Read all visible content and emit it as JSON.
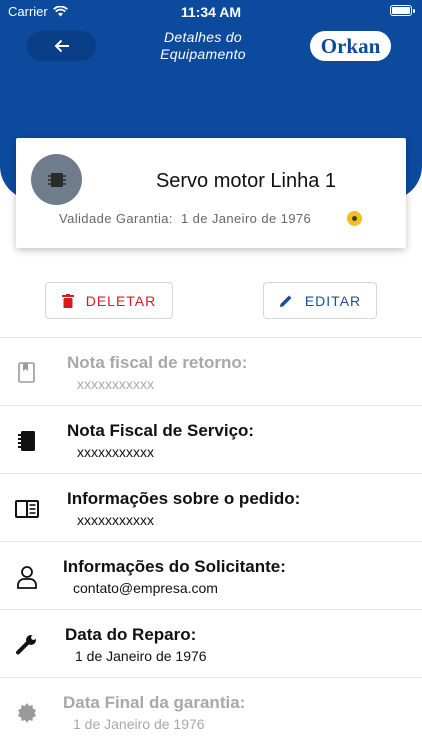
{
  "status_bar": {
    "carrier": "Carrier",
    "time": "11:34 AM"
  },
  "header": {
    "title": "Detalhes do Equipamento",
    "logo_text": "Orkan"
  },
  "device": {
    "name": "Servo motor Linha 1",
    "warranty_label": "Validade Garantia:",
    "warranty_date": "1 de Janeiro de 1976"
  },
  "actions": {
    "delete_label": "DELETAR",
    "edit_label": "EDITAR"
  },
  "details": [
    {
      "label": "Nota fiscal de retorno:",
      "value": "xxxxxxxxxxx",
      "icon": "bookmark-book-icon",
      "disabled": true
    },
    {
      "label": "Nota Fiscal de Serviço:",
      "value": "xxxxxxxxxxx",
      "icon": "notebook-icon",
      "disabled": false
    },
    {
      "label": "Informações sobre o pedido:",
      "value": "xxxxxxxxxxx",
      "icon": "open-book-icon",
      "disabled": false
    },
    {
      "label": "Informações do Solicitante:",
      "value": "contato@empresa.com",
      "icon": "person-icon",
      "disabled": false
    },
    {
      "label": "Data do Reparo:",
      "value": "1 de Janeiro de 1976",
      "icon": "wrench-icon",
      "disabled": false
    },
    {
      "label": "Data Final da garantia:",
      "value": "1 de Janeiro de 1976",
      "icon": "certificate-icon",
      "disabled": true
    }
  ],
  "colors": {
    "primary": "#0c4a9e",
    "danger": "#d71920",
    "accent": "#1a4f9c",
    "warranty_status": "#f3c01b"
  }
}
